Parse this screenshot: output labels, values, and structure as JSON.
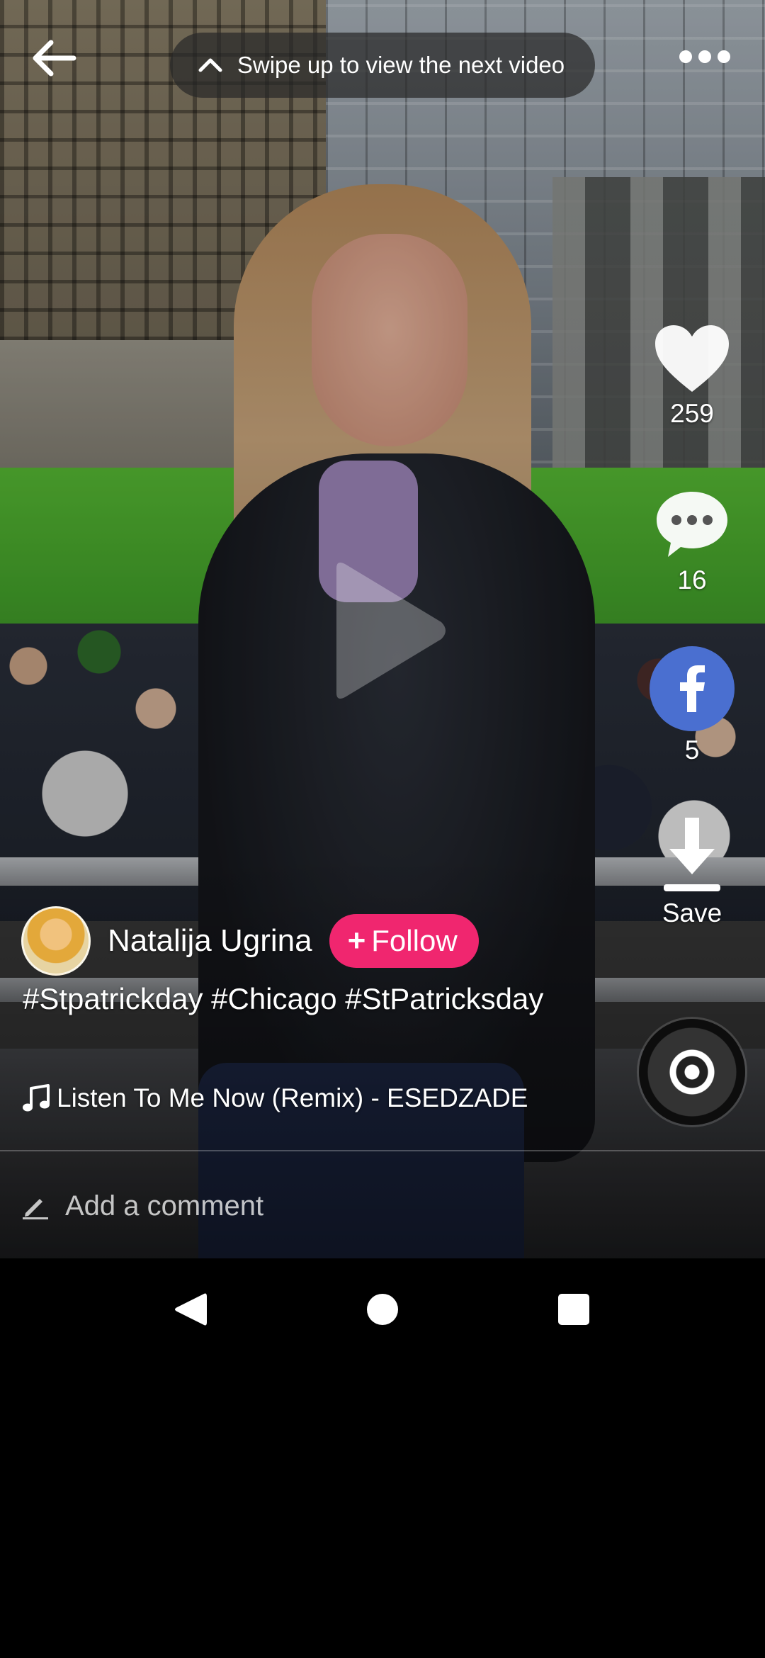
{
  "top_bar": {
    "swipe_hint": "Swipe up to view the next video"
  },
  "actions": {
    "like_count": "259",
    "comment_count": "16",
    "share_count": "5",
    "save_label": "Save"
  },
  "post": {
    "author_name": "Natalija Ugrina",
    "follow_label": "Follow",
    "caption": "#Stpatrickday #Chicago #StPatricksday",
    "music": "Listen To Me Now (Remix) - ESEDZADE"
  },
  "comment": {
    "placeholder": "Add a comment"
  },
  "colors": {
    "follow_button": "#f0266f",
    "facebook_button": "#4a6fd0"
  },
  "icons": {
    "back": "arrow-left-icon",
    "swipe": "chevron-up-icon",
    "more": "more-horizontal-icon",
    "play": "play-icon",
    "like": "heart-icon",
    "comment": "comment-bubble-icon",
    "share": "facebook-icon",
    "save": "download-icon",
    "music": "music-note-icon",
    "comment_edit": "pencil-icon"
  }
}
